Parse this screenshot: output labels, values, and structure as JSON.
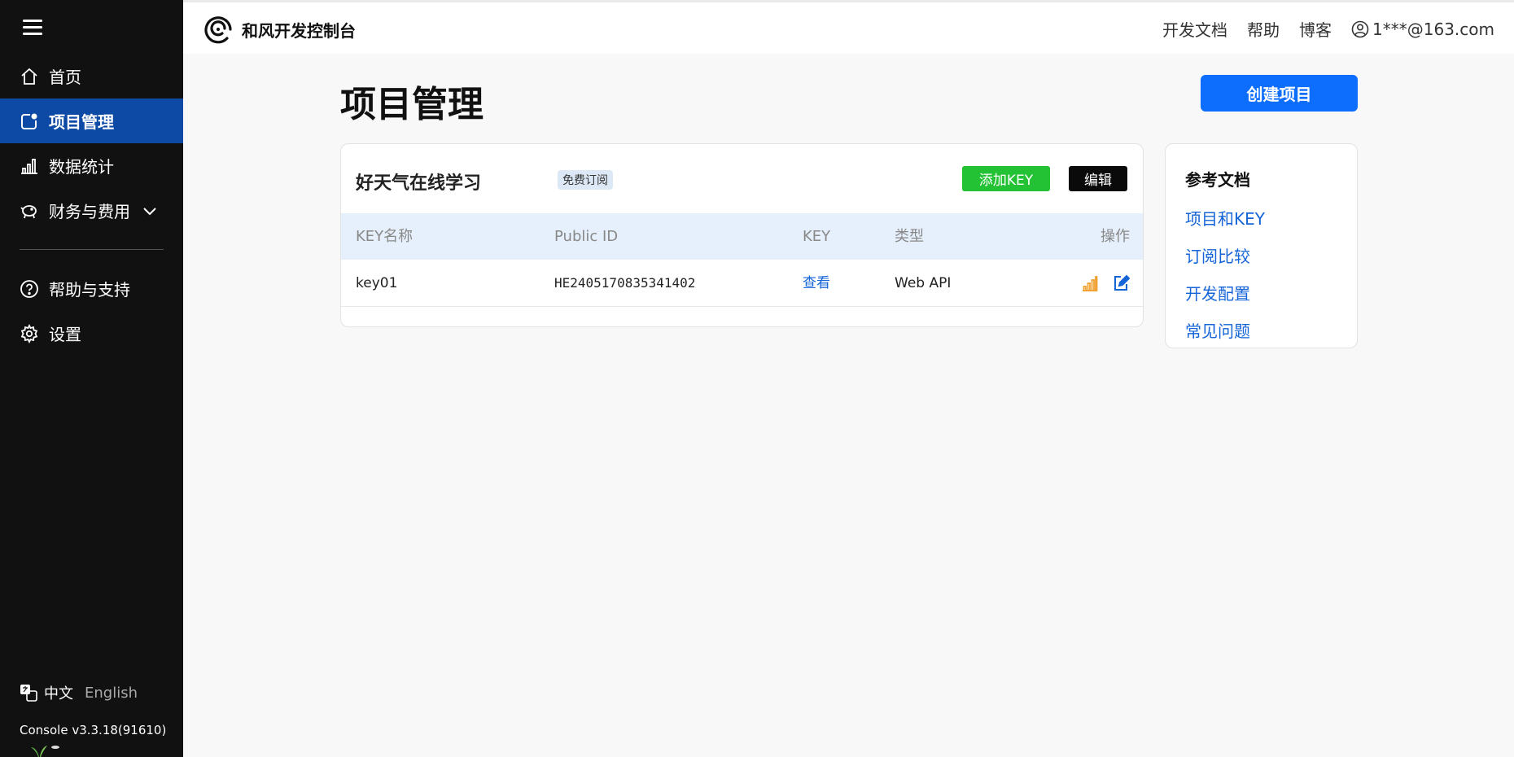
{
  "sidebar": {
    "items": [
      {
        "label": "首页",
        "icon": "home-icon"
      },
      {
        "label": "项目管理",
        "icon": "project-icon",
        "active": true
      },
      {
        "label": "数据统计",
        "icon": "bar-chart-icon"
      },
      {
        "label": "财务与费用",
        "icon": "piggy-bank-icon"
      },
      {
        "label": "帮助与支持",
        "icon": "help-circle-icon"
      },
      {
        "label": "设置",
        "icon": "gear-icon"
      }
    ],
    "lang_zh": "中文",
    "lang_en": "English",
    "version": "Console v3.3.18(91610)"
  },
  "header": {
    "brand": "和风开发控制台",
    "links": [
      "开发文档",
      "帮助",
      "博客"
    ],
    "user": "1***@163.com"
  },
  "main": {
    "title": "项目管理",
    "create_button": "创建项目",
    "project": {
      "name": "好天气在线学习",
      "badge": "免费订阅",
      "add_key": "添加KEY",
      "edit": "编辑",
      "columns": [
        "KEY名称",
        "Public ID",
        "KEY",
        "类型",
        "操作"
      ],
      "rows": [
        {
          "name": "key01",
          "public_id": "HE2405170835341402",
          "key": "查看",
          "type": "Web API"
        }
      ]
    },
    "docs": {
      "title": "参考文档",
      "links": [
        "项目和KEY",
        "订阅比较",
        "开发配置",
        "常见问题"
      ]
    }
  },
  "colors": {
    "sidebar_bg": "#111111",
    "active_nav": "#0c4aa5",
    "primary": "#0d6efd",
    "success": "#22c234",
    "link": "#1565d8",
    "table_header": "#e6f0fc"
  }
}
